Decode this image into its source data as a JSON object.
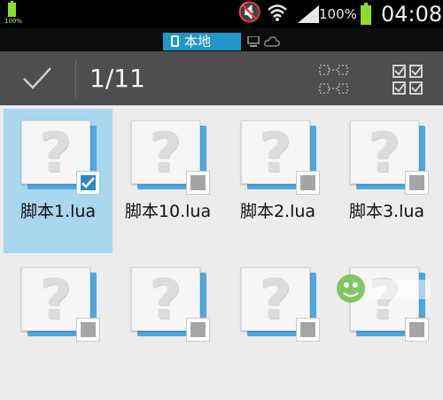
{
  "status_bar": {
    "small_battery_label": "100%",
    "battery_percent": "100%",
    "time": "04:08",
    "icons": [
      "battery-icon",
      "mute-icon",
      "wifi-icon",
      "signal-icon",
      "battery-icon"
    ],
    "colors": {
      "battery": "#8fdc2f",
      "background": "#000000"
    }
  },
  "storage_tabs": {
    "local_label": "本地",
    "local_active": true,
    "other_icons": [
      "computer-icon",
      "cloud-icon"
    ],
    "accent": "#1f98c7"
  },
  "action_bar": {
    "selection_count": "1/11",
    "icons": [
      "check-icon",
      "multi-select-icon",
      "select-all-icon"
    ]
  },
  "files": [
    {
      "name": "脚本1.lua",
      "selected": true
    },
    {
      "name": "脚本10.lua",
      "selected": false
    },
    {
      "name": "脚本2.lua",
      "selected": false
    },
    {
      "name": "脚本3.lua",
      "selected": false
    },
    {
      "name": "",
      "selected": false
    },
    {
      "name": "",
      "selected": false
    },
    {
      "name": "",
      "selected": false
    },
    {
      "name": "",
      "selected": false
    }
  ],
  "colors": {
    "selection_highlight": "#a8d7ef",
    "checkbox_checked": "#2d88c4",
    "checkbox_unchecked": "#a5a5a5",
    "file_accent": "#4da8de"
  }
}
